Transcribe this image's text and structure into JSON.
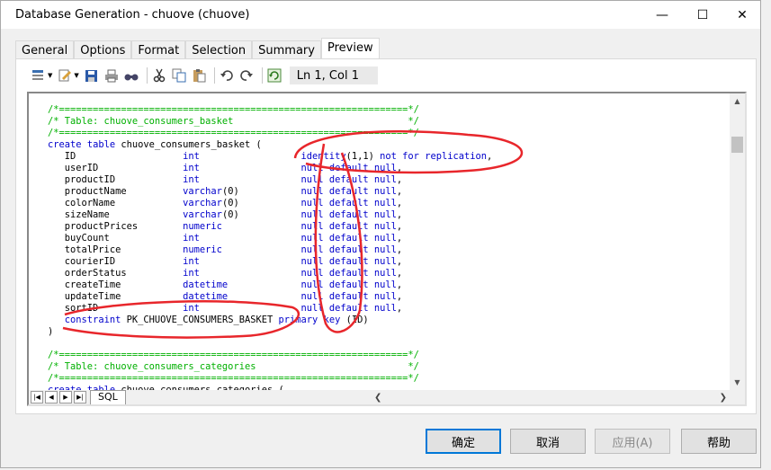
{
  "window": {
    "title": "Database Generation - chuove (chuove)",
    "min_icon": "minimize-icon",
    "max_icon": "maximize-icon",
    "close_icon": "close-icon"
  },
  "tabs": [
    "General",
    "Options",
    "Format",
    "Selection",
    "Summary",
    "Preview"
  ],
  "active_tab": "Preview",
  "toolbar": {
    "icons": [
      "insert-icon",
      "edit-icon",
      "save-icon",
      "print-icon",
      "find-icon",
      "cut-icon",
      "copy-icon",
      "paste-icon",
      "undo-icon",
      "redo-icon",
      "refresh-icon"
    ],
    "position": "Ln 1, Col 1"
  },
  "code_lines": [
    "/*==============================================================*/",
    "/* Table: chuove_consumers_basket                               */",
    "/*==============================================================*/",
    "create table chuove_consumers_basket (",
    "   ID                   int                  identity(1,1) not for replication,",
    "   userID               int                  null default null,",
    "   productID            int                  null default null,",
    "   productName          varchar(0)           null default null,",
    "   colorName            varchar(0)           null default null,",
    "   sizeName             varchar(0)           null default null,",
    "   productPrices        numeric              null default null,",
    "   buyCount             int                  null default null,",
    "   totalPrice           numeric              null default null,",
    "   courierID            int                  null default null,",
    "   orderStatus          int                  null default null,",
    "   createTime           datetime             null default null,",
    "   updateTime           datetime             null default null,",
    "   sortID               int                  null default null,",
    "   constraint PK_CHUOVE_CONSUMERS_BASKET primary key (ID)",
    ")",
    "",
    "/*==============================================================*/",
    "/* Table: chuove_consumers_categories                           */",
    "/*==============================================================*/",
    "create table chuove_consumers_categories ("
  ],
  "editor_tab": "SQL",
  "buttons": {
    "ok": "确定",
    "cancel": "取消",
    "apply": "应用(A)",
    "help": "帮助"
  },
  "colors": {
    "comment": "#00b000",
    "keyword": "#0000cc",
    "annotation": "#e8262b",
    "default_button_border": "#0078d7"
  }
}
